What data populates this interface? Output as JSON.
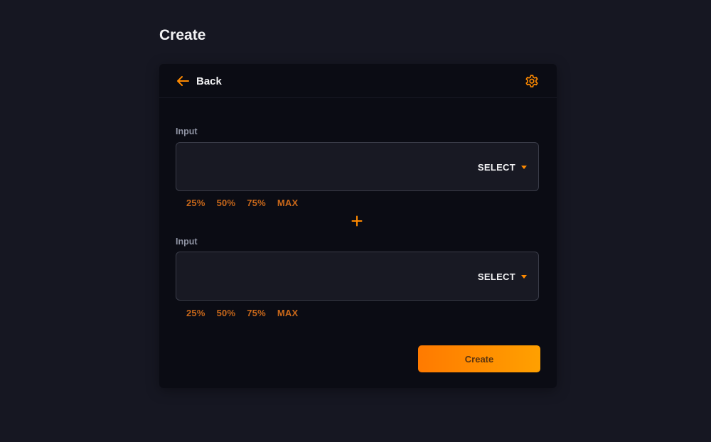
{
  "page": {
    "title": "Create"
  },
  "header": {
    "back_label": "Back",
    "back_icon": "arrow-left-icon",
    "settings_icon": "gear-icon"
  },
  "inputs": [
    {
      "label": "Input",
      "value": "",
      "select_label": "SELECT",
      "percent_options": [
        "25%",
        "50%",
        "75%",
        "MAX"
      ]
    },
    {
      "label": "Input",
      "value": "",
      "select_label": "SELECT",
      "percent_options": [
        "25%",
        "50%",
        "75%",
        "MAX"
      ]
    }
  ],
  "separator_icon": "plus-icon",
  "actions": {
    "create_label": "Create"
  },
  "colors": {
    "background": "#161722",
    "card": "#0b0c14",
    "accent": "#ff8a00",
    "accent_gradient_end": "#ffa000",
    "percent_text": "#c9681a"
  }
}
